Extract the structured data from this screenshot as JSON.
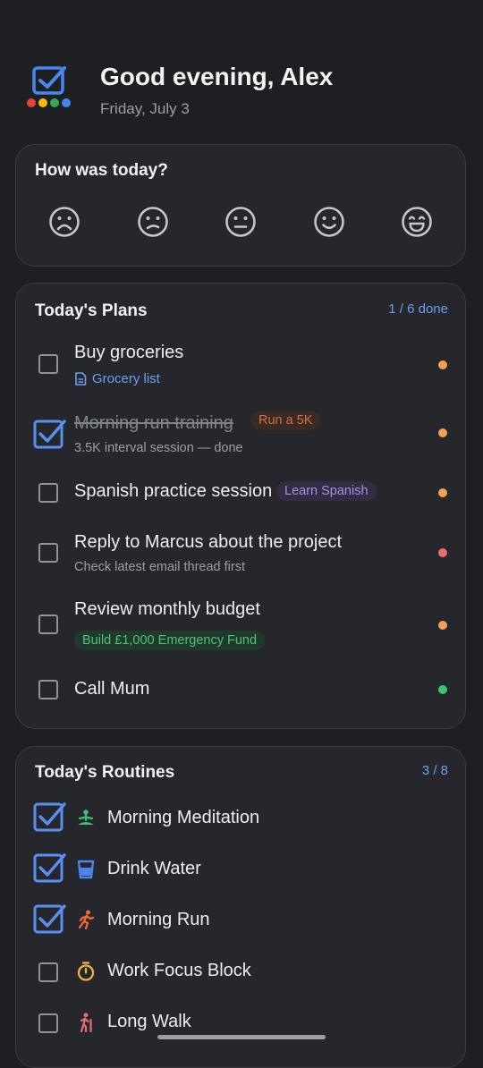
{
  "header": {
    "greeting": "Good evening, Alex",
    "date": "Friday, July 3",
    "logo_colors": [
      "#ea4335",
      "#fbbc05",
      "#34a853",
      "#4285f4"
    ]
  },
  "mood": {
    "title": "How was today?",
    "faces": [
      "very-sad-face-icon",
      "sad-face-icon",
      "neutral-face-icon",
      "happy-face-icon",
      "very-happy-face-icon"
    ]
  },
  "plans": {
    "title": "Today's Plans",
    "count": "1 / 6 done",
    "items": [
      {
        "title": "Buy groceries",
        "link": "Grocery list",
        "done": false,
        "priority_color": "#f5a052"
      },
      {
        "title": "Morning run training",
        "tag": "Run a 5K",
        "subtitle": "3.5K interval session — done",
        "done": true,
        "priority_color": "#f5a052"
      },
      {
        "title": "Spanish practice session",
        "tag": "Learn Spanish",
        "done": false,
        "priority_color": "#f5a052"
      },
      {
        "title": "Reply to Marcus about the project",
        "subtitle": "Check latest email thread first",
        "done": false,
        "priority_color": "#ee6b6e"
      },
      {
        "title": "Review monthly budget",
        "tag": "Build £1,000 Emergency Fund",
        "done": false,
        "priority_color": "#f5a052"
      },
      {
        "title": "Call Mum",
        "done": false,
        "priority_color": "#3cc56c"
      }
    ]
  },
  "routines": {
    "title": "Today's Routines",
    "count": "3 / 8",
    "items": [
      {
        "title": "Morning Meditation",
        "icon": "meditation-icon",
        "done": true
      },
      {
        "title": "Drink Water",
        "icon": "water-glass-icon",
        "done": true
      },
      {
        "title": "Morning Run",
        "icon": "runner-icon",
        "done": true
      },
      {
        "title": "Work Focus Block",
        "icon": "timer-icon",
        "done": false
      },
      {
        "title": "Long Walk",
        "icon": "hiking-icon",
        "done": false
      }
    ]
  },
  "colors": {
    "accent": "#6e9ff0",
    "checkbox_blue": "#5a8ff0",
    "background": "#1e1f23",
    "card": "#26272c"
  }
}
